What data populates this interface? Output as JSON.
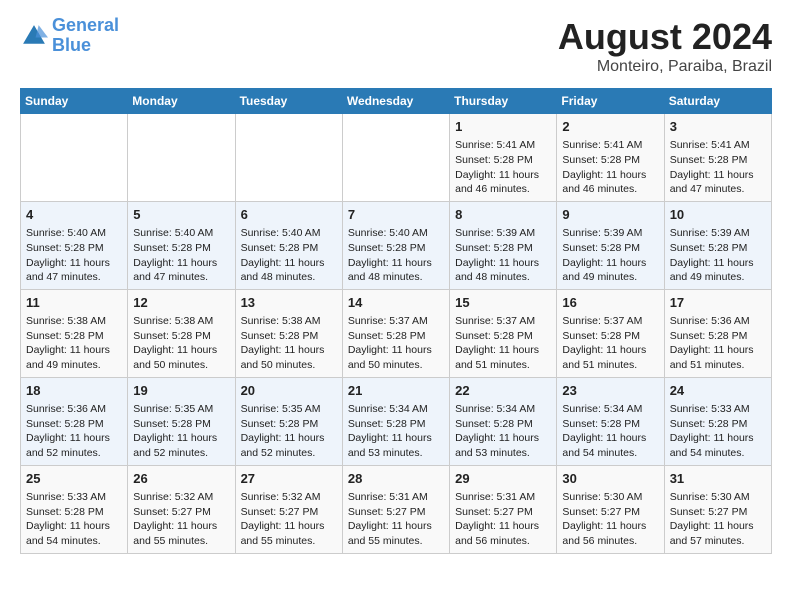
{
  "logo": {
    "line1": "General",
    "line2": "Blue"
  },
  "title": "August 2024",
  "subtitle": "Monteiro, Paraiba, Brazil",
  "weekdays": [
    "Sunday",
    "Monday",
    "Tuesday",
    "Wednesday",
    "Thursday",
    "Friday",
    "Saturday"
  ],
  "weeks": [
    [
      {
        "day": "",
        "info": ""
      },
      {
        "day": "",
        "info": ""
      },
      {
        "day": "",
        "info": ""
      },
      {
        "day": "",
        "info": ""
      },
      {
        "day": "1",
        "info": "Sunrise: 5:41 AM\nSunset: 5:28 PM\nDaylight: 11 hours\nand 46 minutes."
      },
      {
        "day": "2",
        "info": "Sunrise: 5:41 AM\nSunset: 5:28 PM\nDaylight: 11 hours\nand 46 minutes."
      },
      {
        "day": "3",
        "info": "Sunrise: 5:41 AM\nSunset: 5:28 PM\nDaylight: 11 hours\nand 47 minutes."
      }
    ],
    [
      {
        "day": "4",
        "info": "Sunrise: 5:40 AM\nSunset: 5:28 PM\nDaylight: 11 hours\nand 47 minutes."
      },
      {
        "day": "5",
        "info": "Sunrise: 5:40 AM\nSunset: 5:28 PM\nDaylight: 11 hours\nand 47 minutes."
      },
      {
        "day": "6",
        "info": "Sunrise: 5:40 AM\nSunset: 5:28 PM\nDaylight: 11 hours\nand 48 minutes."
      },
      {
        "day": "7",
        "info": "Sunrise: 5:40 AM\nSunset: 5:28 PM\nDaylight: 11 hours\nand 48 minutes."
      },
      {
        "day": "8",
        "info": "Sunrise: 5:39 AM\nSunset: 5:28 PM\nDaylight: 11 hours\nand 48 minutes."
      },
      {
        "day": "9",
        "info": "Sunrise: 5:39 AM\nSunset: 5:28 PM\nDaylight: 11 hours\nand 49 minutes."
      },
      {
        "day": "10",
        "info": "Sunrise: 5:39 AM\nSunset: 5:28 PM\nDaylight: 11 hours\nand 49 minutes."
      }
    ],
    [
      {
        "day": "11",
        "info": "Sunrise: 5:38 AM\nSunset: 5:28 PM\nDaylight: 11 hours\nand 49 minutes."
      },
      {
        "day": "12",
        "info": "Sunrise: 5:38 AM\nSunset: 5:28 PM\nDaylight: 11 hours\nand 50 minutes."
      },
      {
        "day": "13",
        "info": "Sunrise: 5:38 AM\nSunset: 5:28 PM\nDaylight: 11 hours\nand 50 minutes."
      },
      {
        "day": "14",
        "info": "Sunrise: 5:37 AM\nSunset: 5:28 PM\nDaylight: 11 hours\nand 50 minutes."
      },
      {
        "day": "15",
        "info": "Sunrise: 5:37 AM\nSunset: 5:28 PM\nDaylight: 11 hours\nand 51 minutes."
      },
      {
        "day": "16",
        "info": "Sunrise: 5:37 AM\nSunset: 5:28 PM\nDaylight: 11 hours\nand 51 minutes."
      },
      {
        "day": "17",
        "info": "Sunrise: 5:36 AM\nSunset: 5:28 PM\nDaylight: 11 hours\nand 51 minutes."
      }
    ],
    [
      {
        "day": "18",
        "info": "Sunrise: 5:36 AM\nSunset: 5:28 PM\nDaylight: 11 hours\nand 52 minutes."
      },
      {
        "day": "19",
        "info": "Sunrise: 5:35 AM\nSunset: 5:28 PM\nDaylight: 11 hours\nand 52 minutes."
      },
      {
        "day": "20",
        "info": "Sunrise: 5:35 AM\nSunset: 5:28 PM\nDaylight: 11 hours\nand 52 minutes."
      },
      {
        "day": "21",
        "info": "Sunrise: 5:34 AM\nSunset: 5:28 PM\nDaylight: 11 hours\nand 53 minutes."
      },
      {
        "day": "22",
        "info": "Sunrise: 5:34 AM\nSunset: 5:28 PM\nDaylight: 11 hours\nand 53 minutes."
      },
      {
        "day": "23",
        "info": "Sunrise: 5:34 AM\nSunset: 5:28 PM\nDaylight: 11 hours\nand 54 minutes."
      },
      {
        "day": "24",
        "info": "Sunrise: 5:33 AM\nSunset: 5:28 PM\nDaylight: 11 hours\nand 54 minutes."
      }
    ],
    [
      {
        "day": "25",
        "info": "Sunrise: 5:33 AM\nSunset: 5:28 PM\nDaylight: 11 hours\nand 54 minutes."
      },
      {
        "day": "26",
        "info": "Sunrise: 5:32 AM\nSunset: 5:27 PM\nDaylight: 11 hours\nand 55 minutes."
      },
      {
        "day": "27",
        "info": "Sunrise: 5:32 AM\nSunset: 5:27 PM\nDaylight: 11 hours\nand 55 minutes."
      },
      {
        "day": "28",
        "info": "Sunrise: 5:31 AM\nSunset: 5:27 PM\nDaylight: 11 hours\nand 55 minutes."
      },
      {
        "day": "29",
        "info": "Sunrise: 5:31 AM\nSunset: 5:27 PM\nDaylight: 11 hours\nand 56 minutes."
      },
      {
        "day": "30",
        "info": "Sunrise: 5:30 AM\nSunset: 5:27 PM\nDaylight: 11 hours\nand 56 minutes."
      },
      {
        "day": "31",
        "info": "Sunrise: 5:30 AM\nSunset: 5:27 PM\nDaylight: 11 hours\nand 57 minutes."
      }
    ]
  ]
}
